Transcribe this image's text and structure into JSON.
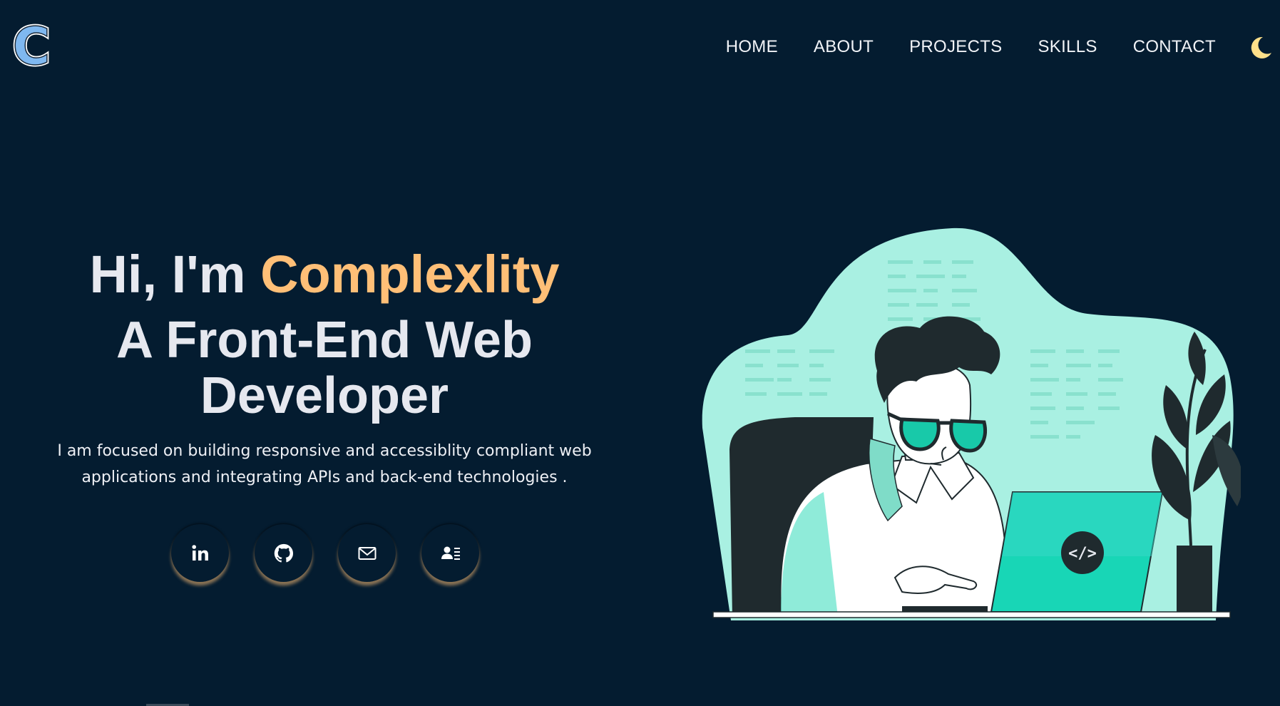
{
  "header": {
    "logo_letter": "C",
    "nav": [
      {
        "label": "HOME"
      },
      {
        "label": "ABOUT"
      },
      {
        "label": "PROJECTS"
      },
      {
        "label": "SKILLS"
      },
      {
        "label": "CONTACT"
      }
    ],
    "theme_toggle_icon": "moon-icon"
  },
  "hero": {
    "greeting": "Hi, I'm ",
    "name": "Complexlity",
    "headline": "A Front-End Web Developer",
    "description": "I am focused on building responsive and accessiblity compliant web applications and integrating APIs and back-end technologies ."
  },
  "socials": [
    {
      "icon": "linkedin-icon"
    },
    {
      "icon": "github-icon"
    },
    {
      "icon": "mail-icon"
    },
    {
      "icon": "contact-card-icon"
    }
  ],
  "illustration": {
    "badge_text": "</>"
  },
  "colors": {
    "background": "#041c30",
    "accent": "#ffbf77",
    "text": "#e6e8ef",
    "moon": "#ffe08a",
    "illustration_bg": "#a9f0e2",
    "laptop": "#18d6b6"
  }
}
